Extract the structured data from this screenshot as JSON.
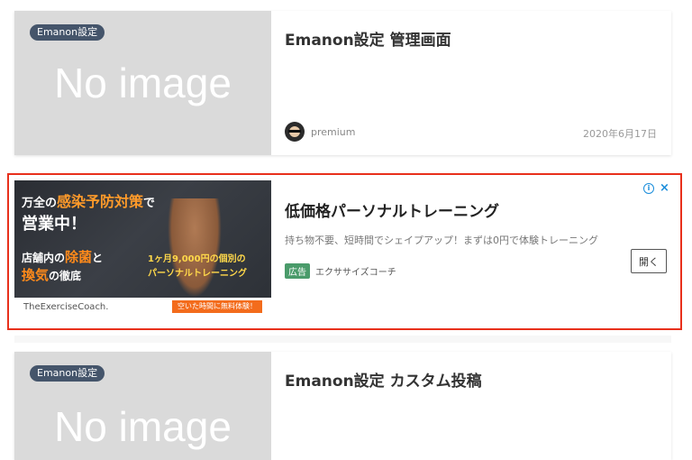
{
  "post1": {
    "category": "Emanon設定",
    "placeholder": "No image",
    "title": "Emanon設定 管理画面",
    "author": "premium",
    "date": "2020年6月17日"
  },
  "ad": {
    "image": {
      "line1_prefix": "万全の",
      "line1_highlight": "感染予防対策",
      "line1_suffix": "で",
      "line2": "営業中！",
      "line3_prefix": "店舗内の",
      "line3_highlight": "除菌",
      "line3_suffix": "と",
      "line4_highlight": "換気",
      "line4_suffix": "の徹底",
      "price_line1": "1ヶ月9,000円の個別の",
      "price_line2": "パーソナルトレーニング",
      "brand": "TheExerciseCoach.",
      "cta": "空いた時間に無料体験！"
    },
    "title": "低価格パーソナルトレーニング",
    "description": "持ち物不要、短時間でシェイプアップ！まずは0円で体験トレーニング",
    "label": "広告",
    "sponsor": "エクササイズコーチ",
    "open_button": "開く",
    "info_icon": "i",
    "close_icon": "×",
    "colors": {
      "highlight_border": "#e8301c",
      "ad_label": "#4a9b6a",
      "adchoice": "#1a8ddb"
    }
  },
  "post2": {
    "category": "Emanon設定",
    "placeholder": "No image",
    "title": "Emanon設定 カスタム投稿"
  }
}
